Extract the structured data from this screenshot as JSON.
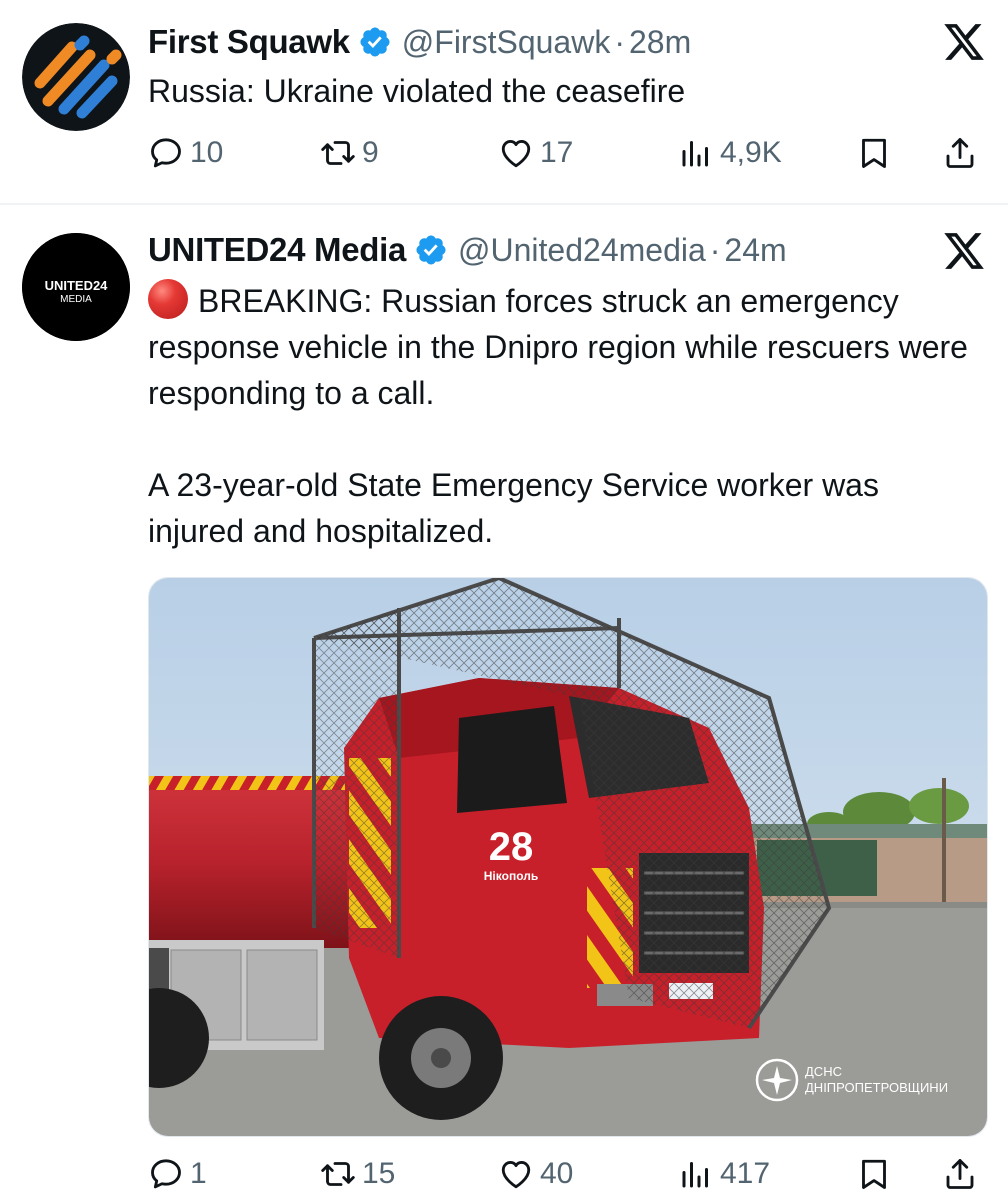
{
  "tweets": [
    {
      "display_name": "First Squawk",
      "handle": "@FirstSquawk",
      "separator": "·",
      "time": "28m",
      "text": [
        "Russia: Ukraine violated the ceasefire"
      ],
      "metrics": {
        "replies": "10",
        "reposts": "9",
        "likes": "17",
        "views": "4,9K"
      }
    },
    {
      "display_name": "UNITED24 Media",
      "handle": "@United24media",
      "separator": "·",
      "time": "24m",
      "text": [
        "BREAKING:  Russian forces struck an emergency response vehicle in the Dnipro region while rescuers were responding to a call.",
        "A 23-year-old State Emergency Service worker was injured and hospitalized."
      ],
      "avatar_text": {
        "line1": "UNITED24",
        "line2": "MEDIA"
      },
      "media": {
        "truck_number": "28",
        "truck_town": "Нікополь",
        "watermark_line1": "ДСНС",
        "watermark_line2": "ДНІПРОПЕТРОВЩИНИ"
      },
      "metrics": {
        "replies": "1",
        "reposts": "15",
        "likes": "40",
        "views": "417"
      }
    }
  ],
  "colors": {
    "verified": "#1d9bf0",
    "text": "#0f1419",
    "secondary": "#536471",
    "truck_red": "#c8202a"
  },
  "icons": [
    "verified-badge-icon",
    "x-logo-icon",
    "reply-icon",
    "repost-icon",
    "like-icon",
    "views-icon",
    "bookmark-icon",
    "share-icon"
  ]
}
